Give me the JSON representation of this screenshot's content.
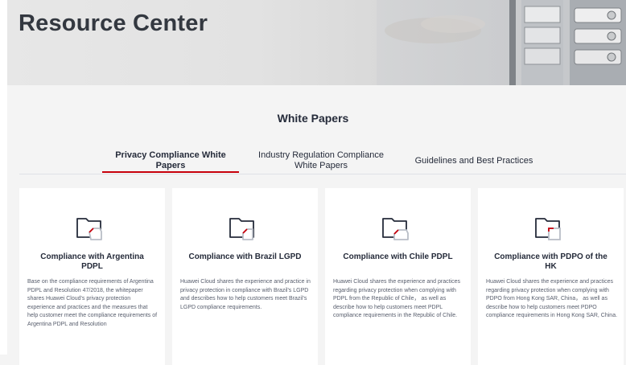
{
  "hero": {
    "title": "Resource Center"
  },
  "section": {
    "title": "White Papers"
  },
  "tabs": [
    {
      "label": "Privacy Compliance White Papers",
      "active": true
    },
    {
      "label": "Industry Regulation Compliance White Papers",
      "active": false
    },
    {
      "label": "Guidelines and Best Practices",
      "active": false
    }
  ],
  "cards": [
    {
      "title": "Compliance with Argentina PDPL",
      "icon": "folder-document-icon",
      "description": "Base on the compliance requirements of Argentina PDPL and Resolution 47/2018, the whitepaper shares Huawei Cloud's privacy protection experience and practices and the measures that help customer meet the compliance requirements of Argentina PDPL and Resolution"
    },
    {
      "title": "Compliance with Brazil LGPD",
      "icon": "folder-document-icon",
      "description": "Huawei Cloud shares the experience and practice in privacy protection in compliance with Brazil's LGPD and describes how to help customers meet Brazil's LGPD compliance requirements."
    },
    {
      "title": "Compliance with Chile PDPL",
      "icon": "folder-document-icon",
      "description": "Huawei Cloud shares the experience and practices regarding privacy protection when complying with PDPL from the Republic of Chile， as well as describe how to help customers meet PDPL compliance requirements in the Republic of Chile."
    },
    {
      "title": "Compliance with PDPO of the HK",
      "icon": "folder-document-icon",
      "description": "Huawei Cloud shares the experience and practices regarding privacy protection when complying with PDPO from Hong Kong SAR, China， as well as describe how to help customers meet PDPO compliance requirements in Hong Kong SAR, China."
    }
  ],
  "colors": {
    "accent": "#c7000b",
    "icon_stroke": "#252b3a",
    "icon_grey": "#b9bec7"
  }
}
